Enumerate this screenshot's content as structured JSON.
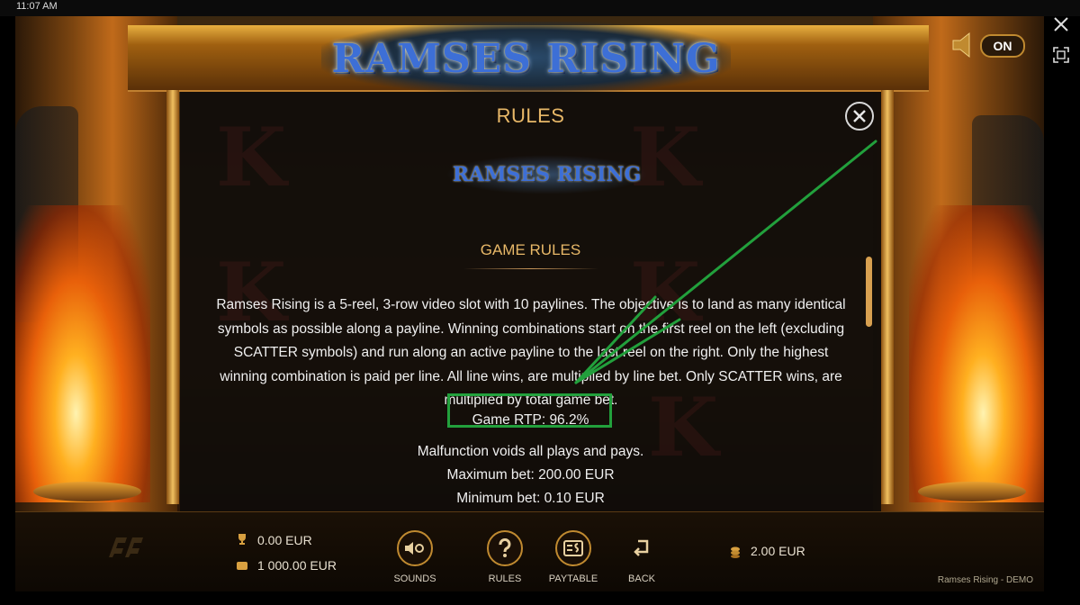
{
  "status_bar": {
    "time": "11:07 AM"
  },
  "game": {
    "logo_text": "RAMSES RISING",
    "sound": {
      "state": "ON"
    }
  },
  "rules_panel": {
    "title": "RULES",
    "mini_logo_text": "RAMSES RISING",
    "section_title": "GAME RULES",
    "paragraph": "Ramses Rising is a 5-reel, 3-row video slot with 10 paylines. The objective is to land as many identical symbols as possible along a payline. Winning combinations start on the first reel on the left (excluding SCATTER symbols) and run along an active payline to the last reel on the right. Only the highest winning combination is paid per line. All line wins, are multiplied by line bet. Only SCATTER wins, are multiplied by total game bet.",
    "rtp": "Game RTP: 96.2%",
    "malfunction": "Malfunction voids all plays and pays.",
    "max_bet": "Maximum bet: 200.00 EUR",
    "min_bet": "Minimum bet: 0.10 EUR"
  },
  "bottom_bar": {
    "last_win": "0.00 EUR",
    "balance": "1 000.00 EUR",
    "controls": [
      {
        "label": "SOUNDS",
        "icon": "sound-settings-icon"
      },
      {
        "label": "RULES",
        "icon": "question-icon"
      },
      {
        "label": "PAYTABLE",
        "icon": "paytable-icon"
      },
      {
        "label": "BACK",
        "icon": "back-arrow-icon"
      }
    ],
    "bet": "2.00 EUR",
    "demo_label": "Ramses Rising - DEMO"
  },
  "colors": {
    "accent_gold": "#e8b868",
    "highlight_green": "#22a03c",
    "panel_bg": "#0f0c0a"
  }
}
